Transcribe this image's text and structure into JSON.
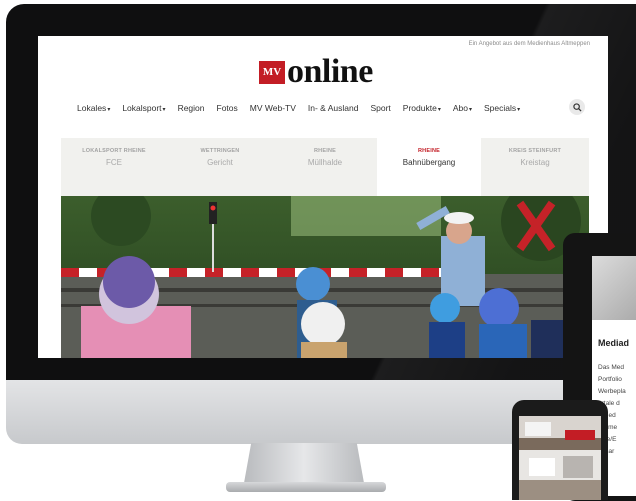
{
  "site": {
    "tagline": "Ein Angebot aus dem Medienhaus Altmeppen",
    "logo_mark": "MV",
    "logo_text": "online"
  },
  "nav": {
    "items": [
      {
        "label": "Lokales",
        "dropdown": true
      },
      {
        "label": "Lokalsport",
        "dropdown": true
      },
      {
        "label": "Region",
        "dropdown": false
      },
      {
        "label": "Fotos",
        "dropdown": false
      },
      {
        "label": "MV Web-TV",
        "dropdown": false
      },
      {
        "label": "In- & Ausland",
        "dropdown": false
      },
      {
        "label": "Sport",
        "dropdown": false
      },
      {
        "label": "Produkte",
        "dropdown": true
      },
      {
        "label": "Abo",
        "dropdown": true
      },
      {
        "label": "Specials",
        "dropdown": true
      }
    ],
    "search_icon": "search-icon",
    "caret": "▾"
  },
  "teasers": [
    {
      "kicker": "LOKALSPORT RHEINE",
      "title": "FCE",
      "active": false
    },
    {
      "kicker": "WETTRINGEN",
      "title": "Gericht",
      "active": false
    },
    {
      "kicker": "RHEINE",
      "title": "Müllhalde",
      "active": false
    },
    {
      "kicker": "RHEINE",
      "title": "Bahnübergang",
      "active": true
    },
    {
      "kicker": "KREIS STEINFURT",
      "title": "Kreistag",
      "active": false
    }
  ],
  "tablet": {
    "heading": "Mediad",
    "lines": [
      "Das Med",
      "Portfolio",
      "Werbepla",
      "ortale d",
      "s Med",
      "ossme",
      "eine/E",
      "gesar"
    ]
  },
  "colors": {
    "brand_red": "#c31d25",
    "device_black": "#0f0f10",
    "teaser_bg": "#f1f1ee"
  }
}
